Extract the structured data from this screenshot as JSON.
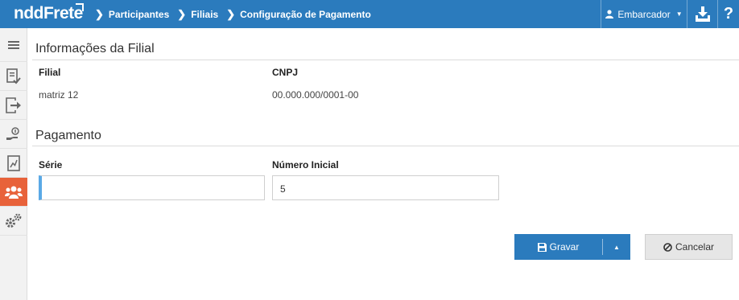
{
  "header": {
    "logo": "nddFrete",
    "breadcrumb": [
      "Participantes",
      "Filiais",
      "Configuração de Pagamento"
    ],
    "user_label": "Embarcador",
    "help_label": "?"
  },
  "sidebar": {
    "items": [
      "menu-icon",
      "checklist-icon",
      "export-icon",
      "payment-icon",
      "report-icon",
      "users-icon",
      "settings-icon"
    ],
    "active_color": "#e8623a"
  },
  "filial_info": {
    "title": "Informações da Filial",
    "col_filial": "Filial",
    "col_cnpj": "CNPJ",
    "filial": "matriz 12",
    "cnpj": "00.000.000/0001-00"
  },
  "pagamento": {
    "title": "Pagamento",
    "serie_label": "Série",
    "serie_value": "",
    "numero_label": "Número Inicial",
    "numero_value": "5"
  },
  "actions": {
    "save_label": "Gravar",
    "cancel_label": "Cancelar"
  },
  "colors": {
    "primary": "#2b7bbd",
    "accent": "#e8623a"
  }
}
